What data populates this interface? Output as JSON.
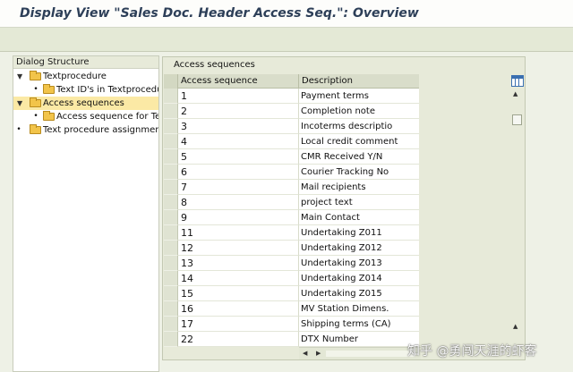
{
  "window": {
    "title": "Display View \"Sales Doc. Header Access Seq.\": Overview"
  },
  "dialog_structure": {
    "header": "Dialog Structure",
    "nodes": [
      {
        "label": "Textprocedure",
        "level": 0,
        "expanded": true,
        "selected": false
      },
      {
        "label": "Text ID's in Textprocedu",
        "level": 1,
        "expanded": false,
        "selected": false
      },
      {
        "label": "Access sequences",
        "level": 0,
        "expanded": true,
        "selected": true
      },
      {
        "label": "Access sequence for Tex",
        "level": 1,
        "expanded": false,
        "selected": false
      },
      {
        "label": "Text procedure assignment",
        "level": 0,
        "expanded": false,
        "selected": false
      }
    ]
  },
  "table": {
    "title": "Access sequences",
    "columns": [
      "Access sequence",
      "Description"
    ],
    "rows": [
      {
        "seq": "1",
        "desc": "Payment terms"
      },
      {
        "seq": "2",
        "desc": "Completion note"
      },
      {
        "seq": "3",
        "desc": "Incoterms descriptio"
      },
      {
        "seq": "4",
        "desc": "Local credit comment"
      },
      {
        "seq": "5",
        "desc": "CMR Received Y/N"
      },
      {
        "seq": "6",
        "desc": "Courier Tracking No"
      },
      {
        "seq": "7",
        "desc": "Mail recipients"
      },
      {
        "seq": "8",
        "desc": "project text"
      },
      {
        "seq": "9",
        "desc": "Main Contact"
      },
      {
        "seq": "11",
        "desc": "Undertaking Z011"
      },
      {
        "seq": "12",
        "desc": "Undertaking Z012"
      },
      {
        "seq": "13",
        "desc": "Undertaking Z013"
      },
      {
        "seq": "14",
        "desc": "Undertaking Z014"
      },
      {
        "seq": "15",
        "desc": "Undertaking Z015"
      },
      {
        "seq": "16",
        "desc": "MV Station Dimens."
      },
      {
        "seq": "17",
        "desc": "Shipping terms (CA)"
      },
      {
        "seq": "22",
        "desc": "DTX Number"
      }
    ]
  },
  "watermark": "知乎 @勇闯天涯的虾客",
  "colors": {
    "title_text": "#2d3f58",
    "selection": "#fbe9a5",
    "folder": "#f2c44a",
    "panel": "#e7ead9"
  }
}
